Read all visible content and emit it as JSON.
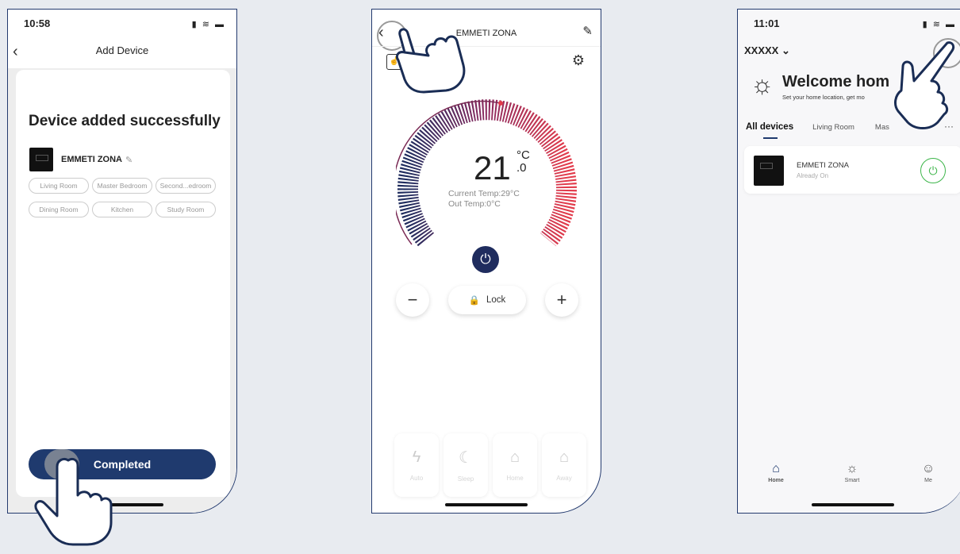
{
  "screen1": {
    "time": "10:58",
    "status_icons": "▮ ≋ ▬",
    "back_glyph": "‹",
    "title": "Add Device",
    "headline": "Device added successfully",
    "device_name": "EMMETI ZONA",
    "rooms": [
      "Living Room",
      "Master Bedroom",
      "Second...edroom",
      "Dining Room",
      "Kitchen",
      "Study Room"
    ],
    "completed_label": "Completed"
  },
  "screen2": {
    "title": "EMMETI ZONA",
    "temp_int": "21",
    "temp_unit": "°C",
    "temp_dec": ".0",
    "current_temp": "Current Temp:29°C",
    "out_temp": "Out Temp:0°C",
    "lock_label": "Lock",
    "modes": [
      {
        "label": "Auto",
        "icon": "lightning-auto-icon"
      },
      {
        "label": "Sleep",
        "icon": "moon-zz-icon"
      },
      {
        "label": "Home",
        "icon": "house-icon"
      },
      {
        "label": "Away",
        "icon": "house-away-icon"
      }
    ]
  },
  "screen3": {
    "time": "11:01",
    "status_icons": "▮ ≋ ▬",
    "home_selector": "XXXXX ⌄",
    "welcome": "Welcome hom",
    "welcome_sub": "Set your home location, get mo",
    "tabs": [
      "All devices",
      "Living Room",
      "Mas"
    ],
    "more": "···",
    "device_name": "EMMETI ZONA",
    "device_status": "Already On",
    "nav": [
      {
        "label": "Home",
        "icon": "home-icon"
      },
      {
        "label": "Smart",
        "icon": "sun-icon"
      },
      {
        "label": "Me",
        "icon": "user-icon"
      }
    ]
  },
  "colors": {
    "accent": "#1f3a6e",
    "border": "#233a6e",
    "power_green": "#3db54a",
    "dial_cold": "#1f2c5e",
    "dial_hot": "#e23b4b"
  }
}
